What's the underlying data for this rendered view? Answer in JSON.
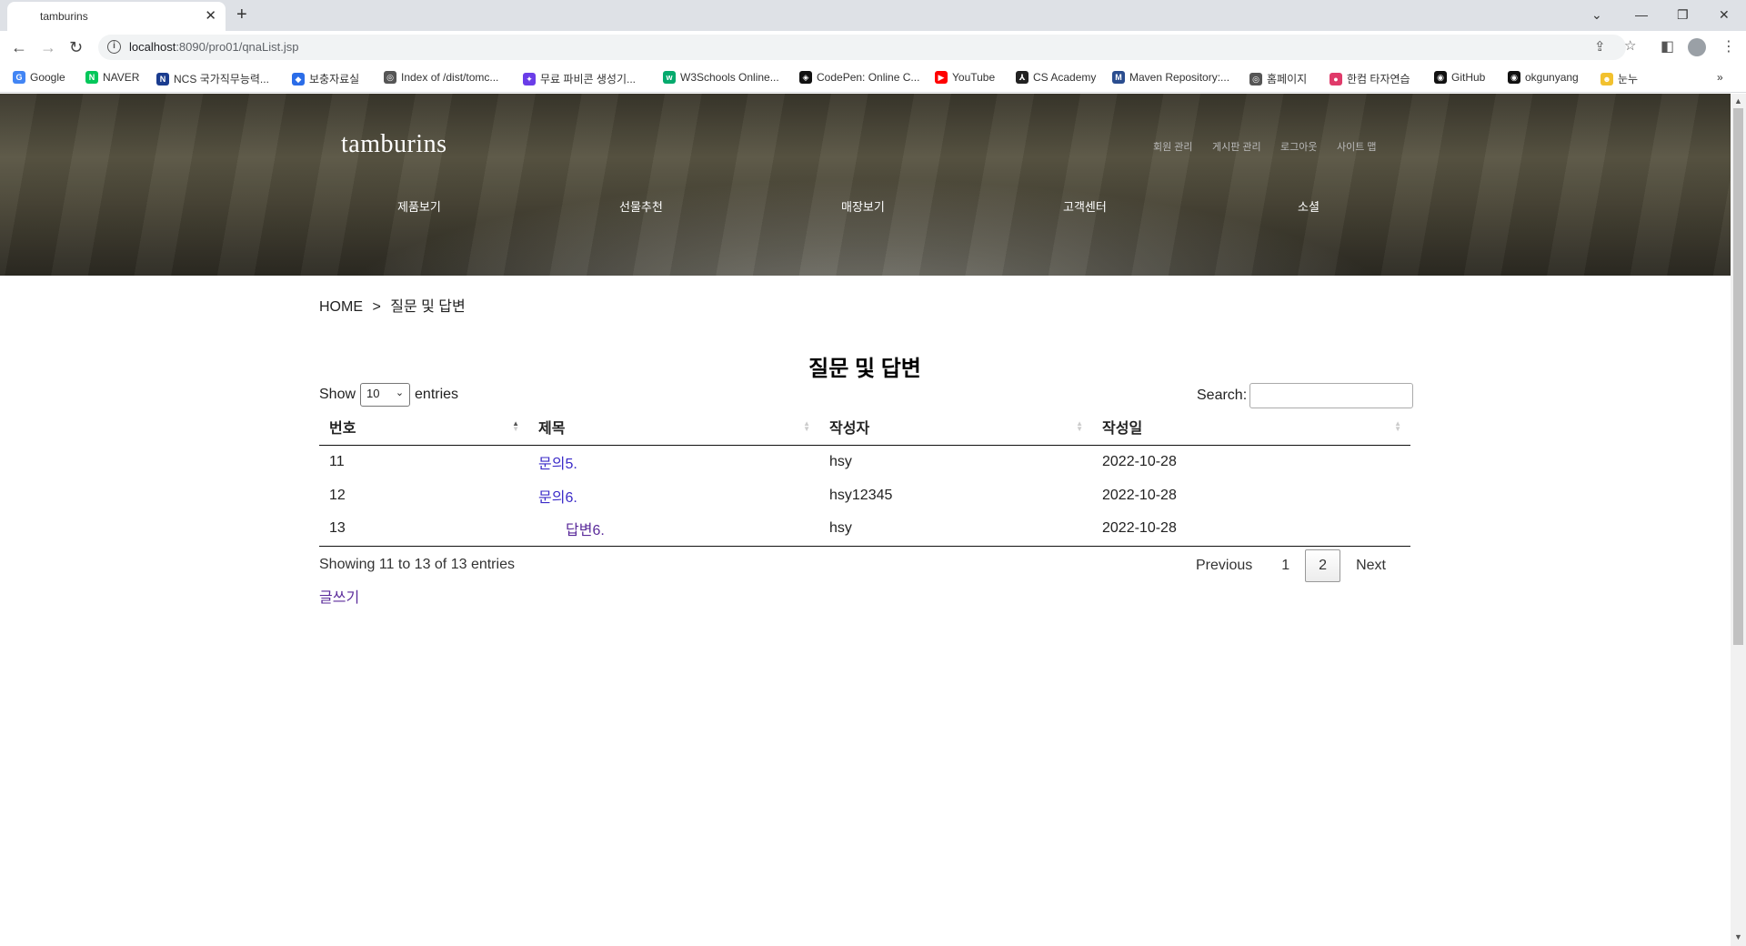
{
  "browser": {
    "tab_title": "tamburins",
    "url_host": "localhost",
    "url_rest": ":8090/pro01/qnaList.jsp",
    "bookmarks": [
      {
        "label": "Google",
        "color": "#4285f4",
        "glyph": "G"
      },
      {
        "label": "NAVER",
        "color": "#03c75a",
        "glyph": "N"
      },
      {
        "label": "NCS 국가직무능력...",
        "color": "#1a3c8f",
        "glyph": "N"
      },
      {
        "label": "보충자료실",
        "color": "#2b6de8",
        "glyph": "◆"
      },
      {
        "label": "Index of /dist/tomc...",
        "color": "#555555",
        "glyph": "◎"
      },
      {
        "label": "무료 파비콘 생성기...",
        "color": "#6a3de8",
        "glyph": "✦"
      },
      {
        "label": "W3Schools Online...",
        "color": "#04aa6d",
        "glyph": "w"
      },
      {
        "label": "CodePen: Online C...",
        "color": "#111111",
        "glyph": "◈"
      },
      {
        "label": "YouTube",
        "color": "#ff0000",
        "glyph": "▶"
      },
      {
        "label": "CS Academy",
        "color": "#222222",
        "glyph": "⅄"
      },
      {
        "label": "Maven Repository:...",
        "color": "#2a4d8f",
        "glyph": "M"
      },
      {
        "label": "홈페이지",
        "color": "#555555",
        "glyph": "◎"
      },
      {
        "label": "한컴 타자연습",
        "color": "#e03a6a",
        "glyph": "●"
      },
      {
        "label": "GitHub",
        "color": "#111111",
        "glyph": "◉"
      },
      {
        "label": "okgunyang",
        "color": "#111111",
        "glyph": "◉"
      },
      {
        "label": "눈누",
        "color": "#f2c12e",
        "glyph": "☻"
      }
    ]
  },
  "site": {
    "logo": "tamburins",
    "util_links": [
      "회원 관리",
      "게시판 관리",
      "로그아웃",
      "사이트 맵"
    ],
    "menu": [
      "제품보기",
      "선물추천",
      "매장보기",
      "고객센터",
      "소셜"
    ]
  },
  "breadcrumb": {
    "home": "HOME",
    "separator": ">",
    "current": "질문 및 답변"
  },
  "page_title": "질문 및 답변",
  "table_controls": {
    "show_label": "Show",
    "page_length": "10",
    "entries_label": "entries",
    "search_label": "Search:",
    "search_value": ""
  },
  "table": {
    "columns": [
      "번호",
      "제목",
      "작성자",
      "작성일"
    ],
    "rows": [
      {
        "no": "11",
        "title": "문의5.",
        "author": "hsy",
        "date": "2022-10-28"
      },
      {
        "no": "12",
        "title": "문의6.",
        "author": "hsy12345",
        "date": "2022-10-28"
      },
      {
        "no": "13",
        "title": "답변6.",
        "author": "hsy",
        "date": "2022-10-28"
      }
    ]
  },
  "footer": {
    "info": "Showing 11 to 13 of 13 entries",
    "previous": "Previous",
    "pages": [
      "1",
      "2"
    ],
    "current_page": "2",
    "next": "Next",
    "write": "글쓰기"
  }
}
